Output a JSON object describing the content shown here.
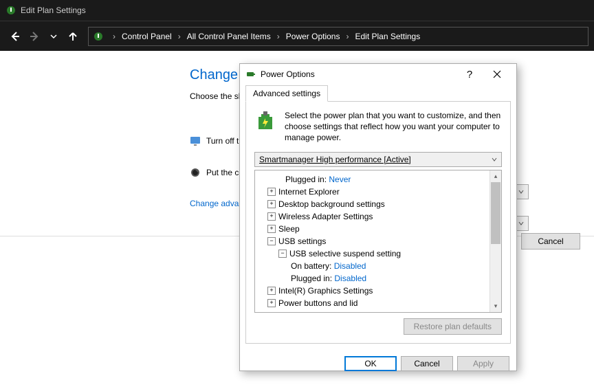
{
  "window": {
    "title": "Edit Plan Settings"
  },
  "breadcrumb": {
    "items": [
      "Control Panel",
      "All Control Panel Items",
      "Power Options",
      "Edit Plan Settings"
    ]
  },
  "page": {
    "heading": "Change se",
    "subtext": "Choose the sle",
    "row1_label": "Turn off t",
    "row2_label": "Put the co",
    "advanced_link": "Change advar",
    "cancel": "Cancel"
  },
  "dialog": {
    "title": "Power Options",
    "tab": "Advanced settings",
    "intro": "Select the power plan that you want to customize, and then choose settings that reflect how you want your computer to manage power.",
    "plan": "Smartmanager High performance [Active]",
    "tree": {
      "plugged_in_label": "Plugged in:",
      "plugged_in_value": "Never",
      "ie": "Internet Explorer",
      "desktop": "Desktop background settings",
      "wireless": "Wireless Adapter Settings",
      "sleep": "Sleep",
      "usb": "USB settings",
      "usb_suspend": "USB selective suspend setting",
      "on_battery_label": "On battery:",
      "on_battery_value": "Disabled",
      "pi2_label": "Plugged in:",
      "pi2_value": "Disabled",
      "intel": "Intel(R) Graphics Settings",
      "power_buttons": "Power buttons and lid"
    },
    "restore": "Restore plan defaults",
    "ok": "OK",
    "cancel": "Cancel",
    "apply": "Apply"
  }
}
